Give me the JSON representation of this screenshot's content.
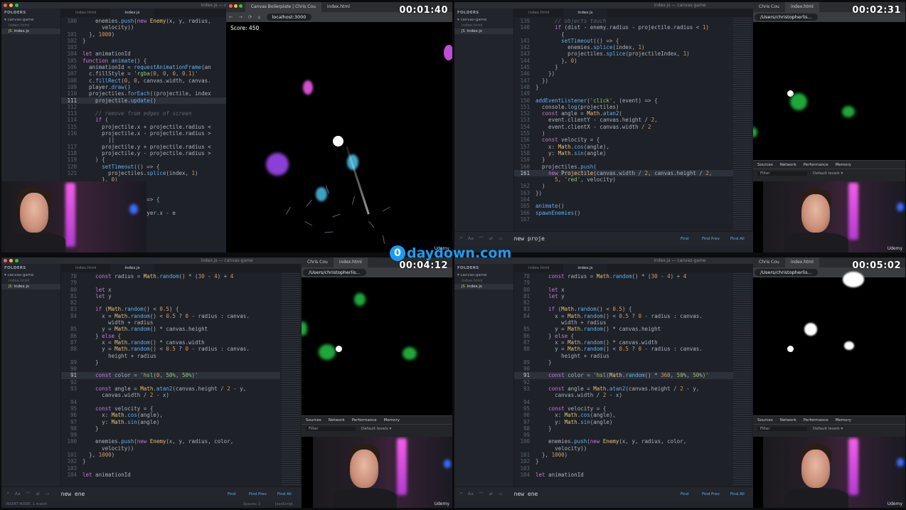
{
  "timers": [
    "00:01:40",
    "00:02:31",
    "00:04:12",
    "00:05:02"
  ],
  "watermark": {
    "circle": "0",
    "text": "daydown.com"
  },
  "editor": {
    "titlebar": "index.js — canvas-game",
    "folders_label": "FOLDERS",
    "project": "canvas-game",
    "files": [
      "index.html",
      "index.js"
    ],
    "tabs": [
      "index.html",
      "index.js"
    ],
    "find_buttons": [
      "Find",
      "Find Prev",
      "Find All"
    ],
    "status_left": "INSERT MODE, 1 match",
    "status_mid": "Spaces: 2",
    "status_right": "JavaScript"
  },
  "browser": {
    "tab1": "Canvas Boilerplate | Chris Cou",
    "tab1_short": "Chris Cou",
    "tab2": "index.html",
    "url": "localhost:3000",
    "url_file": "/Users/christopherlis...",
    "score": "Score: 450",
    "devtools_tabs": [
      "Sources",
      "Network",
      "Performance",
      "Memory"
    ],
    "filter_placeholder": "Filter",
    "levels": "Default levels ▾",
    "udemy": "Udemy"
  },
  "q1": {
    "find_query": "new Enemy",
    "code": [
      {
        "n": "100",
        "t": "    enemies.push(new Enemy(x, y, radius,"
      },
      {
        "n": "",
        "t": "      velocity))"
      },
      {
        "n": "101",
        "t": "  }, 1000)"
      },
      {
        "n": "102",
        "t": "}"
      },
      {
        "n": "103",
        "t": ""
      },
      {
        "n": "104",
        "t": "let animationId"
      },
      {
        "n": "105",
        "t": "function animate() {"
      },
      {
        "n": "106",
        "t": "  animationId = requestAnimationFrame(an"
      },
      {
        "n": "107",
        "t": "  c.fillStyle = 'rgba(0, 0, 0, 0.1)'"
      },
      {
        "n": "108",
        "t": "  c.fillRect(0, 0, canvas.width, canvas."
      },
      {
        "n": "109",
        "t": "  player.draw()"
      },
      {
        "n": "110",
        "t": "  projectiles.forEach((projectile, index"
      },
      {
        "n": "111",
        "t": "    projectile.update()",
        "hl": true
      },
      {
        "n": "112",
        "t": ""
      },
      {
        "n": "113",
        "t": "    // remove from edges of screen"
      },
      {
        "n": "114",
        "t": "    if ("
      },
      {
        "n": "115",
        "t": "      projectile.x + projectile.radius <"
      },
      {
        "n": "116",
        "t": "      projectile.x - projectile.radius >"
      },
      {
        "n": "",
        "t": "        ||"
      },
      {
        "n": "117",
        "t": "      projectile.y + projectile.radius <"
      },
      {
        "n": "118",
        "t": "      projectile.y - projectile.radius >"
      },
      {
        "n": "119",
        "t": "    ) {"
      },
      {
        "n": "120",
        "t": "      setTimeout(() => {"
      },
      {
        "n": "121",
        "t": "        projectiles.splice(index, 1)"
      },
      {
        "n": "",
        "t": "      }, 0)"
      },
      {
        "n": "",
        "t": "    }"
      },
      {
        "n": "",
        "t": ""
      },
      {
        "n": "",
        "t": "    ((enemy, index) => {"
      },
      {
        "n": "",
        "t": ""
      },
      {
        "n": "",
        "t": "      Math.hypot(player.x - e"
      },
      {
        "n": "",
        "t": "    )"
      }
    ]
  },
  "q2": {
    "find_query": "new proje",
    "code": [
      {
        "n": "139",
        "t": "      // objects touch"
      },
      {
        "n": "140",
        "t": "      if (dist - enemy.radius - projectile.radius < 1)"
      },
      {
        "n": "",
        "t": "        {"
      },
      {
        "n": "141",
        "t": "        setTimeout(() => {"
      },
      {
        "n": "142",
        "t": "          enemies.splice(index, 1)"
      },
      {
        "n": "143",
        "t": "          projectiles.splice(projectileIndex, 1)"
      },
      {
        "n": "144",
        "t": "        }, 0)"
      },
      {
        "n": "145",
        "t": "      }"
      },
      {
        "n": "146",
        "t": "    })"
      },
      {
        "n": "147",
        "t": "  })"
      },
      {
        "n": "148",
        "t": "}"
      },
      {
        "n": "149",
        "t": ""
      },
      {
        "n": "150",
        "t": "addEventListener('click', (event) => {"
      },
      {
        "n": "151",
        "t": "  console.log(projectiles)"
      },
      {
        "n": "152",
        "t": "  const angle = Math.atan2("
      },
      {
        "n": "153",
        "t": "    event.clientY - canvas.height / 2,"
      },
      {
        "n": "154",
        "t": "    event.clientX - canvas.width / 2"
      },
      {
        "n": "155",
        "t": "  )"
      },
      {
        "n": "156",
        "t": "  const velocity = {"
      },
      {
        "n": "157",
        "t": "    x: Math.cos(angle),"
      },
      {
        "n": "158",
        "t": "    y: Math.sin(angle)"
      },
      {
        "n": "159",
        "t": "  }"
      },
      {
        "n": "160",
        "t": "  projectiles.push("
      },
      {
        "n": "161",
        "t": "    new Projectile(canvas.width / 2, canvas.height / 2,",
        "hl": true
      },
      {
        "n": "",
        "t": "      5, 'red', velocity)"
      },
      {
        "n": "162",
        "t": "  )"
      },
      {
        "n": "163",
        "t": "})"
      },
      {
        "n": "164",
        "t": ""
      },
      {
        "n": "165",
        "t": "animate()"
      },
      {
        "n": "166",
        "t": "spawnEnemies()"
      },
      {
        "n": "167",
        "t": ""
      }
    ]
  },
  "q3": {
    "find_query": "new ene",
    "code": [
      {
        "n": "78",
        "t": "    const radius = Math.random() * (30 - 4) + 4"
      },
      {
        "n": "79",
        "t": ""
      },
      {
        "n": "80",
        "t": "    let x"
      },
      {
        "n": "81",
        "t": "    let y"
      },
      {
        "n": "82",
        "t": ""
      },
      {
        "n": "83",
        "t": "    if (Math.random() < 0.5) {"
      },
      {
        "n": "84",
        "t": "      x = Math.random() < 0.5 ? 0 - radius : canvas."
      },
      {
        "n": "",
        "t": "        width + radius"
      },
      {
        "n": "85",
        "t": "      y = Math.random() * canvas.height"
      },
      {
        "n": "86",
        "t": "    } else {"
      },
      {
        "n": "87",
        "t": "      x = Math.random() * canvas.width"
      },
      {
        "n": "88",
        "t": "      y = Math.random() < 0.5 ? 0 - radius : canvas."
      },
      {
        "n": "",
        "t": "        height + radius"
      },
      {
        "n": "89",
        "t": "    }"
      },
      {
        "n": "90",
        "t": ""
      },
      {
        "n": "91",
        "t": "    const color = 'hsl(0, 50%, 50%)'",
        "hl": true
      },
      {
        "n": "92",
        "t": ""
      },
      {
        "n": "93",
        "t": "    const angle = Math.atan2(canvas.height / 2 - y,"
      },
      {
        "n": "",
        "t": "      canvas.width / 2 - x)"
      },
      {
        "n": "94",
        "t": ""
      },
      {
        "n": "95",
        "t": "    const velocity = {"
      },
      {
        "n": "96",
        "t": "      x: Math.cos(angle),"
      },
      {
        "n": "97",
        "t": "      y: Math.sin(angle)"
      },
      {
        "n": "98",
        "t": "    }"
      },
      {
        "n": "99",
        "t": ""
      },
      {
        "n": "100",
        "t": "    enemies.push(new Enemy(x, y, radius, color,"
      },
      {
        "n": "",
        "t": "      velocity))"
      },
      {
        "n": "101",
        "t": "  }, 1000)"
      },
      {
        "n": "102",
        "t": "}"
      },
      {
        "n": "103",
        "t": ""
      },
      {
        "n": "104",
        "t": "let animationId"
      }
    ]
  },
  "q4": {
    "find_query": "new ene",
    "code": [
      {
        "n": "78",
        "t": "    const radius = Math.random() * (30 - 4) + 4"
      },
      {
        "n": "79",
        "t": ""
      },
      {
        "n": "80",
        "t": "    let x"
      },
      {
        "n": "81",
        "t": "    let y"
      },
      {
        "n": "82",
        "t": ""
      },
      {
        "n": "83",
        "t": "    if (Math.random() < 0.5) {"
      },
      {
        "n": "84",
        "t": "      x = Math.random() < 0.5 ? 0 - radius : canvas."
      },
      {
        "n": "",
        "t": "        width + radius"
      },
      {
        "n": "85",
        "t": "      y = Math.random() * canvas.height"
      },
      {
        "n": "86",
        "t": "    } else {"
      },
      {
        "n": "87",
        "t": "      x = Math.random() * canvas.width"
      },
      {
        "n": "88",
        "t": "      y = Math.random() < 0.5 ? 0 - radius : canvas."
      },
      {
        "n": "",
        "t": "        height + radius"
      },
      {
        "n": "89",
        "t": "    }"
      },
      {
        "n": "90",
        "t": ""
      },
      {
        "n": "91",
        "t": "    const color = 'hsl(Math.random() * 360, 50%, 50%)'",
        "hl": true
      },
      {
        "n": "92",
        "t": ""
      },
      {
        "n": "93",
        "t": "    const angle = Math.atan2(canvas.height / 2 - y,"
      },
      {
        "n": "",
        "t": "      canvas.width / 2 - x)"
      },
      {
        "n": "94",
        "t": ""
      },
      {
        "n": "95",
        "t": "    const velocity = {"
      },
      {
        "n": "96",
        "t": "      x: Math.cos(angle),"
      },
      {
        "n": "97",
        "t": "      y: Math.sin(angle)"
      },
      {
        "n": "98",
        "t": "    }"
      },
      {
        "n": "99",
        "t": ""
      },
      {
        "n": "100",
        "t": "    enemies.push(new Enemy(x, y, radius, color,"
      },
      {
        "n": "",
        "t": "      velocity))"
      },
      {
        "n": "101",
        "t": "  }, 1000)"
      },
      {
        "n": "102",
        "t": "}"
      },
      {
        "n": "103",
        "t": ""
      },
      {
        "n": "104",
        "t": "let animationId"
      }
    ]
  }
}
